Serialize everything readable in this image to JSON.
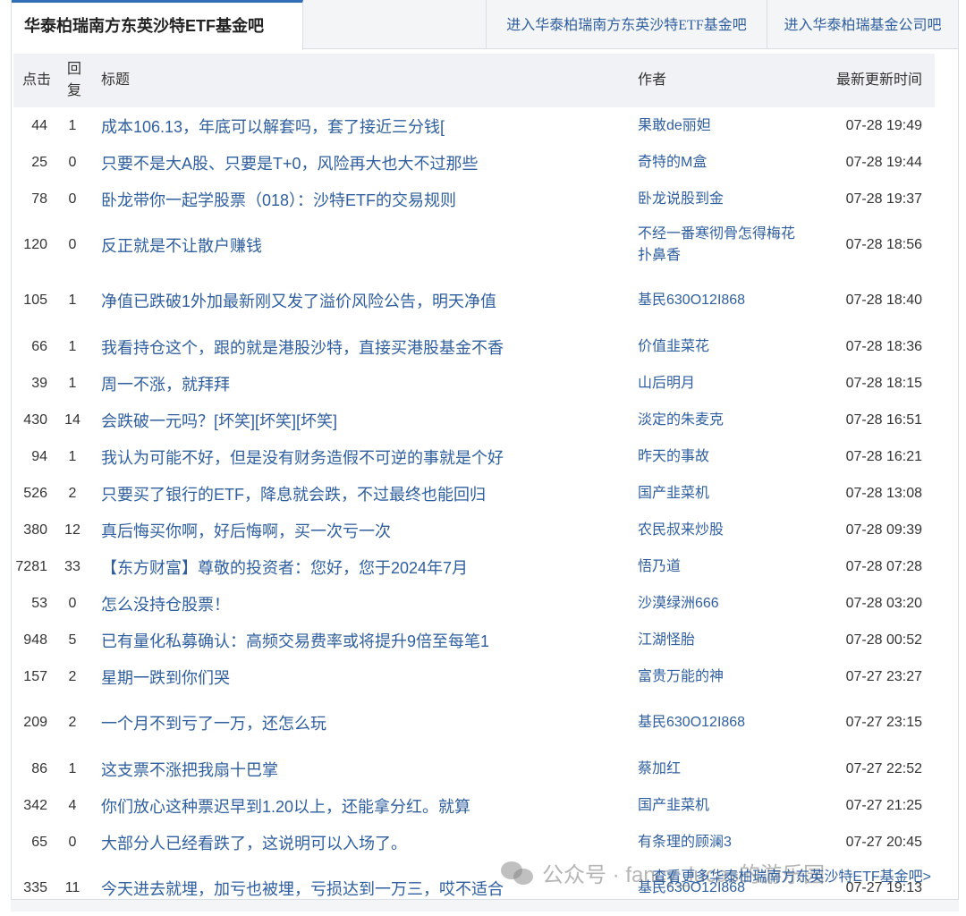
{
  "tabs": {
    "active": "华泰柏瑞南方东英沙特ETF基金吧",
    "link1": "进入华泰柏瑞南方东英沙特ETF基金吧",
    "link2": "进入华泰柏瑞基金公司吧"
  },
  "headers": {
    "clicks": "点击",
    "replies_top": "回",
    "replies_bottom": "复",
    "title": "标题",
    "author": "作者",
    "time": "最新更新时间"
  },
  "rows": [
    {
      "clicks": "44",
      "replies": "1",
      "title": "成本106.13，年底可以解套吗，套了接近三分钱[",
      "author": "果敢de丽妲",
      "time": "07-28 19:49"
    },
    {
      "clicks": "25",
      "replies": "0",
      "title": "只要不是大A股、只要是T+0，风险再大也大不过那些",
      "author": "奇特的M盒",
      "time": "07-28 19:44"
    },
    {
      "clicks": "78",
      "replies": "0",
      "title": "卧龙带你一起学股票（018）：沙特ETF的交易规则",
      "author": "卧龙说股到金",
      "time": "07-28 19:37"
    },
    {
      "clicks": "120",
      "replies": "0",
      "title": "反正就是不让散户赚钱",
      "author": "不经一番寒彻骨怎得梅花扑鼻香",
      "time": "07-28 18:56"
    },
    {
      "clicks": "105",
      "replies": "1",
      "title": "净值已跌破1外加最新刚又发了溢价风险公告，明天净值",
      "author": "基民630O12I868",
      "time": "07-28 18:40"
    },
    {
      "clicks": "66",
      "replies": "1",
      "title": "我看持仓这个，跟的就是港股沙特，直接买港股基金不香",
      "author": "价值韭菜花",
      "time": "07-28 18:36"
    },
    {
      "clicks": "39",
      "replies": "1",
      "title": "周一不涨，就拜拜",
      "author": "山后明月",
      "time": "07-28 18:15"
    },
    {
      "clicks": "430",
      "replies": "14",
      "title": "会跌破一元吗？[坏笑][坏笑][坏笑]",
      "author": "淡定的朱麦克",
      "time": "07-28 16:51"
    },
    {
      "clicks": "94",
      "replies": "1",
      "title": "我认为可能不好，但是没有财务造假不可逆的事就是个好",
      "author": "昨天的事故",
      "time": "07-28 16:21"
    },
    {
      "clicks": "526",
      "replies": "2",
      "title": "只要买了银行的ETF，降息就会跌，不过最终也能回归",
      "author": "国产韭菜机",
      "time": "07-28 13:08"
    },
    {
      "clicks": "380",
      "replies": "12",
      "title": "真后悔买你啊，好后悔啊，买一次亏一次",
      "author": "农民叔来炒股",
      "time": "07-28 09:39"
    },
    {
      "clicks": "7281",
      "replies": "33",
      "title": "【东方财富】尊敬的投资者：您好，您于2024年7月",
      "author": "悟乃道",
      "time": "07-28 07:28"
    },
    {
      "clicks": "53",
      "replies": "0",
      "title": "怎么没持仓股票！",
      "author": "沙漠绿洲666",
      "time": "07-28 03:20"
    },
    {
      "clicks": "948",
      "replies": "5",
      "title": "已有量化私募确认：高频交易费率或将提升9倍至每笔1",
      "author": "江湖怪胎",
      "time": "07-28 00:52"
    },
    {
      "clicks": "157",
      "replies": "2",
      "title": "星期一跌到你们哭",
      "author": "富贵万能的神",
      "time": "07-27 23:27"
    },
    {
      "clicks": "209",
      "replies": "2",
      "title": "一个月不到亏了一万，还怎么玩",
      "author": "基民630O12I868",
      "time": "07-27 23:15"
    },
    {
      "clicks": "86",
      "replies": "1",
      "title": "这支票不涨把我扇十巴掌",
      "author": "蔡加红",
      "time": "07-27 22:52"
    },
    {
      "clicks": "342",
      "replies": "4",
      "title": "你们放心这种票迟早到1.20以上，还能拿分红。就算",
      "author": "国产韭菜机",
      "time": "07-27 21:25"
    },
    {
      "clicks": "65",
      "replies": "0",
      "title": "大部分人已经看跌了，这说明可以入场了。",
      "author": "有条理的顾澜3",
      "time": "07-27 20:45"
    },
    {
      "clicks": "335",
      "replies": "11",
      "title": "今天进去就埋，加亏也被埋，亏损达到一万三，哎不适合",
      "author": "基民630O12I868",
      "time": "07-27 19:13"
    }
  ],
  "footer": {
    "more_link": "查看更多华泰柏瑞南方东英沙特ETF基金吧>"
  },
  "watermark": {
    "text": "公众号 · fancy_lucas的游乐园"
  }
}
